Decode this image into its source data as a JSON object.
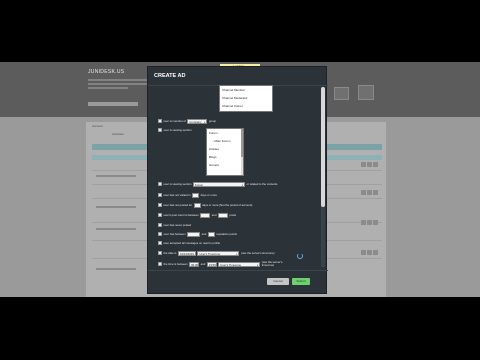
{
  "site": {
    "title": "JUNIDESK.US",
    "tabs": [
      "Account",
      "Activities"
    ]
  },
  "modal": {
    "title": "CREATE AD",
    "loading": "Loading...",
    "cancel_label": "Cancel",
    "submit_label": "Submit",
    "channel_list": [
      "Channel Member",
      "Channel Moderator",
      "Channel Owner"
    ],
    "conditions": [
      {
        "text_before": "user is member of",
        "select_value": "Company",
        "text_after": "group"
      },
      {
        "text_before": "user is viewing section",
        "select_value": "",
        "text_after": ""
      },
      {
        "text_before": "user is viewing section",
        "select_value": "Forum",
        "text_after": "or related to the contents"
      },
      {
        "text_before": "user has not visited in",
        "input": "",
        "text_after": "days or more"
      },
      {
        "text_before": "user has not posted for",
        "input": "",
        "text_after": "days or more (Not the period of account)"
      },
      {
        "text_before": "user's post count is between",
        "input": "",
        "text_mid": "and",
        "input2": "",
        "text_after": "posts"
      },
      {
        "text_before": "user has never posted",
        "input": "",
        "text_after": ""
      },
      {
        "text_before": "user has between",
        "input": "",
        "text_mid": "and",
        "input2": "",
        "text_after": "reputation points"
      },
      {
        "text_before": "user accepted all messages on users's profile",
        "input": "",
        "text_after": ""
      },
      {
        "text_before": "the date is",
        "input": "01/01/2019",
        "select_value": "User's Timezone",
        "text_after": "(use the server's timezone)"
      },
      {
        "text_before": "the time is between",
        "input": "00:00",
        "text_mid": "and",
        "input2": "23:59",
        "select_value": "User's Timezone",
        "text_after": "(use the server's timezone)"
      }
    ],
    "section_list": [
      "Forum",
      "– Main Forum",
      "Articles",
      "Blogs",
      "Groups"
    ]
  }
}
